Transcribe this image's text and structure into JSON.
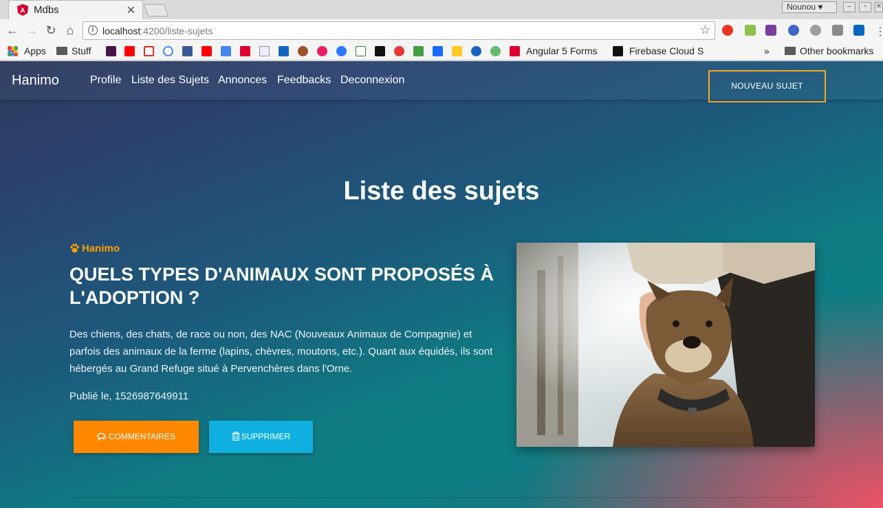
{
  "browser": {
    "tab_title": "Mdbs",
    "profile_name": "Nounou",
    "url_host": "localhost",
    "url_path": ":4200/liste-sujets",
    "bookmarks": [
      {
        "label": "Apps"
      },
      {
        "label": "Stuff"
      },
      {
        "label": "Angular 5 Forms"
      },
      {
        "label": "Firebase Cloud S"
      },
      {
        "label": "Other bookmarks"
      }
    ],
    "overflow": "»"
  },
  "navbar": {
    "brand": "Hanimo",
    "links": [
      "Profile",
      "Liste des Sujets",
      "Annonces",
      "Feedbacks",
      "Deconnexion"
    ],
    "new_subject": "NOUVEAU SUJET",
    "accent_color": "#f5a623"
  },
  "main": {
    "heading": "Liste des sujets",
    "posts": [
      {
        "author": "Hanimo",
        "title": "QUELS TYPES D'ANIMAUX SONT PROPOSÉS À L'ADOPTION ?",
        "body": "Des chiens, des chats, de race ou non, des NAC (Nouveaux Animaux de Compagnie) et parfois des animaux de la ferme (lapins, chèvres, moutons, etc.). Quant aux équidés, ils sont hébergés au Grand Refuge situé à Pervenchères dans l'Orne.",
        "date": "Publié le, 1526987649911",
        "comments_label": "COMMENTAIRES",
        "delete_label": "SUPPRIMER",
        "comments_color": "#ff8800",
        "delete_color": "#0fb0e0",
        "image": "dog-photo"
      }
    ]
  }
}
